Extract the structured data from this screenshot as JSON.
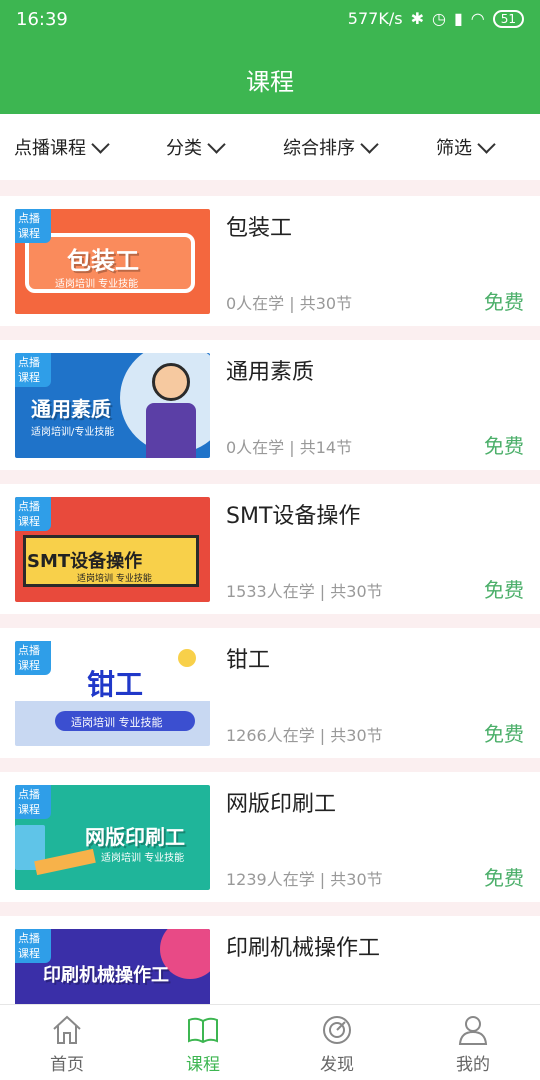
{
  "status": {
    "time": "16:39",
    "net": "577K/s",
    "battery": "51"
  },
  "header": {
    "title": "课程"
  },
  "filters": [
    "点播课程",
    "分类",
    "综合排序",
    "筛选"
  ],
  "courses": [
    {
      "tag": "点播课程",
      "banner": "包装工",
      "sub": "适岗培训 专业技能",
      "name": "包装工",
      "learners": "0人在学 | 共30节",
      "price": "免费"
    },
    {
      "tag": "点播课程",
      "banner": "通用素质",
      "sub": "适岗培训/专业技能",
      "name": "通用素质",
      "learners": "0人在学 | 共14节",
      "price": "免费"
    },
    {
      "tag": "点播课程",
      "banner": "SMT设备操作",
      "sub": "适岗培训 专业技能",
      "name": "SMT设备操作",
      "learners": "1533人在学 | 共30节",
      "price": "免费"
    },
    {
      "tag": "点播课程",
      "banner": "钳工",
      "sub": "适岗培训 专业技能",
      "name": "钳工",
      "learners": "1266人在学 | 共30节",
      "price": "免费"
    },
    {
      "tag": "点播课程",
      "banner": "网版印刷工",
      "sub": "适岗培训 专业技能",
      "name": "网版印刷工",
      "learners": "1239人在学 | 共30节",
      "price": "免费"
    },
    {
      "tag": "点播课程",
      "banner": "印刷机械操作工",
      "sub": "",
      "name": "印刷机械操作工",
      "learners": "",
      "price": ""
    }
  ],
  "tabs": [
    {
      "label": "首页",
      "icon": "home-icon"
    },
    {
      "label": "课程",
      "icon": "book-icon"
    },
    {
      "label": "发现",
      "icon": "compass-icon"
    },
    {
      "label": "我的",
      "icon": "user-icon"
    }
  ],
  "colors": {
    "brand": "#3db651",
    "price": "#4caf6a"
  }
}
